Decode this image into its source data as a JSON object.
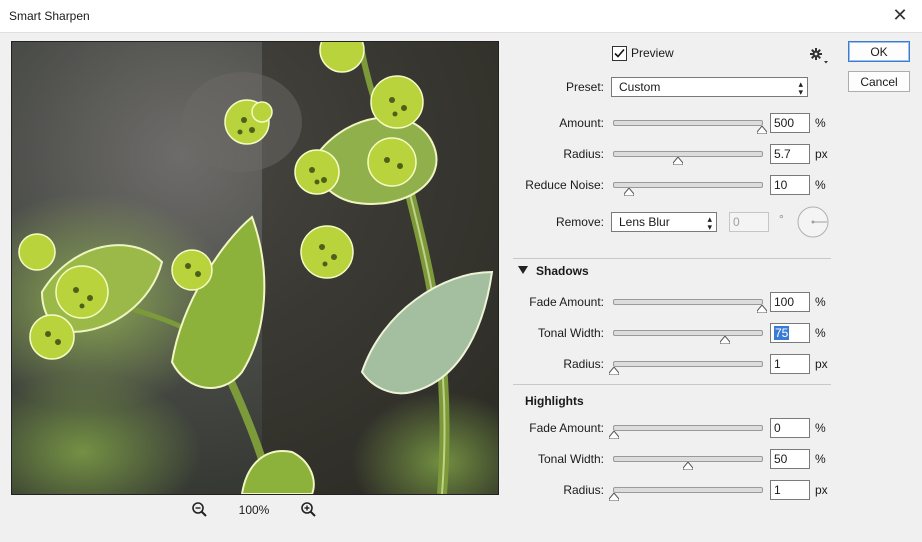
{
  "window": {
    "title": "Smart Sharpen"
  },
  "icons": {
    "close": "close-icon",
    "gear": "gear-icon",
    "zoom_out": "zoom-out-icon",
    "zoom_in": "zoom-in-icon"
  },
  "preview": {
    "label": "Preview",
    "checked": true,
    "zoom": "100%"
  },
  "buttons": {
    "ok": "OK",
    "cancel": "Cancel"
  },
  "preset": {
    "label": "Preset:",
    "value": "Custom"
  },
  "sharpen": {
    "amount": {
      "label": "Amount:",
      "value": "500",
      "unit": "%",
      "position": 1.0
    },
    "radius": {
      "label": "Radius:",
      "value": "5.7",
      "unit": "px",
      "position": 0.43
    },
    "reduce_noise": {
      "label": "Reduce Noise:",
      "value": "10",
      "unit": "%",
      "position": 0.1
    }
  },
  "remove": {
    "label": "Remove:",
    "value": "Lens Blur",
    "angle": "0",
    "angle_unit": "°"
  },
  "shadows": {
    "heading": "Shadows",
    "fade_amount": {
      "label": "Fade Amount:",
      "value": "100",
      "unit": "%",
      "position": 1.0
    },
    "tonal_width": {
      "label": "Tonal Width:",
      "value": "75",
      "unit": "%",
      "position": 0.75
    },
    "radius": {
      "label": "Radius:",
      "value": "1",
      "unit": "px",
      "position": 0.0
    }
  },
  "highlights": {
    "heading": "Highlights",
    "fade_amount": {
      "label": "Fade Amount:",
      "value": "0",
      "unit": "%",
      "position": 0.0
    },
    "tonal_width": {
      "label": "Tonal Width:",
      "value": "50",
      "unit": "%",
      "position": 0.5
    },
    "radius": {
      "label": "Radius:",
      "value": "1",
      "unit": "px",
      "position": 0.0
    }
  },
  "colors": {
    "accent": "#3a7bd5",
    "slider_track": "#dcdcdc"
  }
}
